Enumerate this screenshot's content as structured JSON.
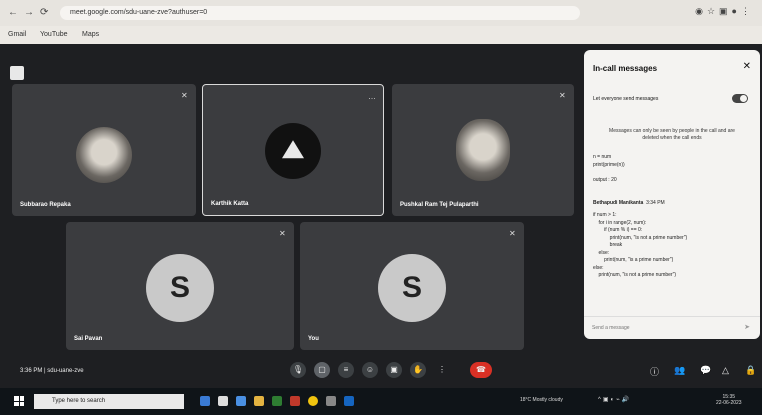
{
  "browser": {
    "url": "meet.google.com/sdu-uane-zve?authuser=0",
    "bookmarks": [
      "Gmail",
      "YouTube",
      "Maps"
    ]
  },
  "participants": [
    {
      "name": "Subbarao Repaka"
    },
    {
      "name": "Karthik Katta"
    },
    {
      "name": "Pushkal Ram Tej Pulaparthi"
    },
    {
      "name": "Sai Pavan",
      "initial": "S"
    },
    {
      "name": "You",
      "initial": "S"
    }
  ],
  "chat": {
    "title": "In-call messages",
    "toggle_label": "Let everyone send messages",
    "note": "Messages can only be seen by people in the call and are deleted when the call ends",
    "message1": "n = num\nprint(prime(n))\n\noutput : 20",
    "sender": "Bethapudi Manikanta",
    "sender_time": "3:34 PM",
    "message2": "if num > 1:\n    for i in range(2, num):\n        if (num % i) == 0:\n            print(num, \"is not a prime number\")\n            break\n    else:\n        print(num, \"is a prime number\")\nelse:\n    print(num, \"is not a prime number\")",
    "input_placeholder": "Send a message"
  },
  "meeting": {
    "time": "3:36 PM",
    "code": "sdu-uane-zve"
  },
  "taskbar": {
    "search_placeholder": "Type here to search",
    "weather": "18°C  Mostly cloudy",
    "time": "15:35",
    "date": "22-06-2023"
  },
  "colors": {
    "end_call": "#d93025",
    "meet_bg": "#1e1f22",
    "tile": "#3b3c3f"
  }
}
